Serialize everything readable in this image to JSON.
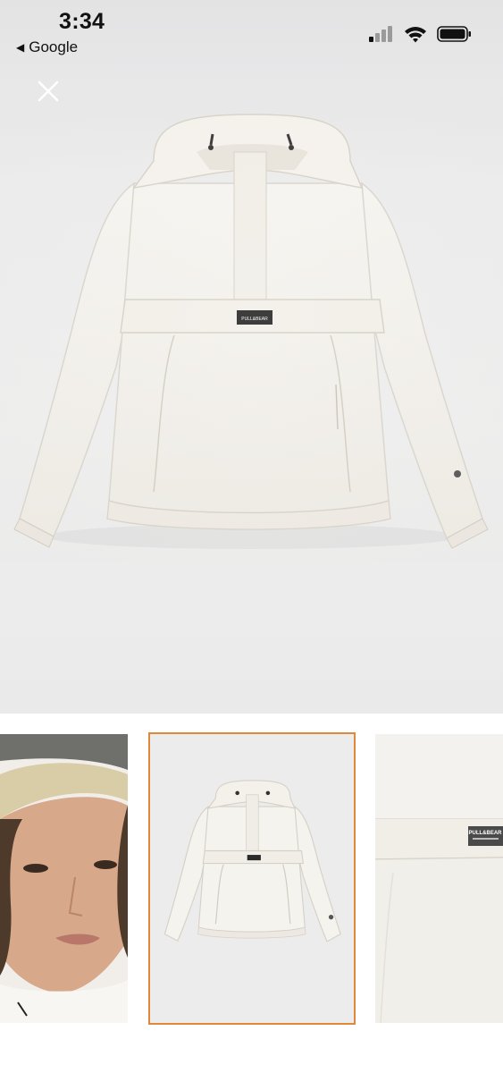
{
  "status_bar": {
    "time": "3:34",
    "back_label": "Google",
    "icons": [
      "cellular-signal-icon",
      "wifi-icon",
      "battery-icon"
    ]
  },
  "viewer": {
    "close_icon": "close-icon",
    "hero_label": "PULL&BEAR"
  },
  "thumbnails": [
    {
      "name": "model-face"
    },
    {
      "name": "jacket-front",
      "selected": true
    },
    {
      "name": "jacket-detail",
      "label": "PULL&BEAR"
    }
  ],
  "colors": {
    "selected_border": "#e0873a",
    "background": "#efefef",
    "jacket": "#f4f2ed"
  }
}
